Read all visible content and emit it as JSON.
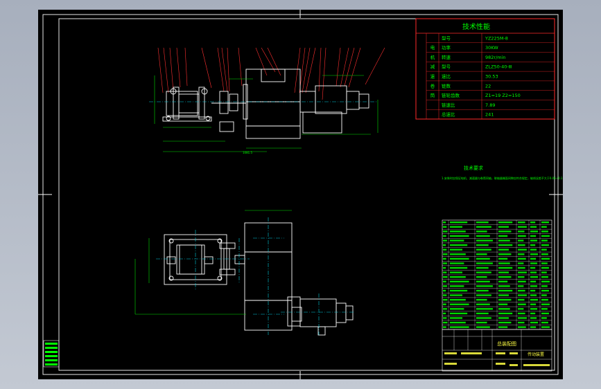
{
  "tech_table": {
    "title": "技术性能",
    "rows": [
      {
        "group": "",
        "key": "型号",
        "value": "YZ225M-8"
      },
      {
        "group": "电",
        "key": "功率",
        "value": "30KW"
      },
      {
        "group": "机",
        "key": "转速",
        "value": "982r/min"
      },
      {
        "group": "减",
        "key": "型号",
        "value": "ZLZ50-40-Ⅲ"
      },
      {
        "group": "速",
        "key": "速比",
        "value": "30.53"
      },
      {
        "group": "卷",
        "key": "链数",
        "value": "22"
      },
      {
        "group": "筒",
        "key": "链轮齿数",
        "value": "Z1=19  Z2=150"
      },
      {
        "group": "",
        "key": "链速比",
        "value": "7.89"
      },
      {
        "group": "",
        "key": "总速比",
        "value": "241"
      }
    ]
  },
  "requirements": {
    "title": "技术要求",
    "text": "1.安装时应保证电机、减速器与卷筒同轴，联轴器端面间隙应符合规定，轴线误差不大于0.04~0.1"
  },
  "title_block": {
    "drawing_title": "总装配图",
    "name_text": "传动装置"
  }
}
